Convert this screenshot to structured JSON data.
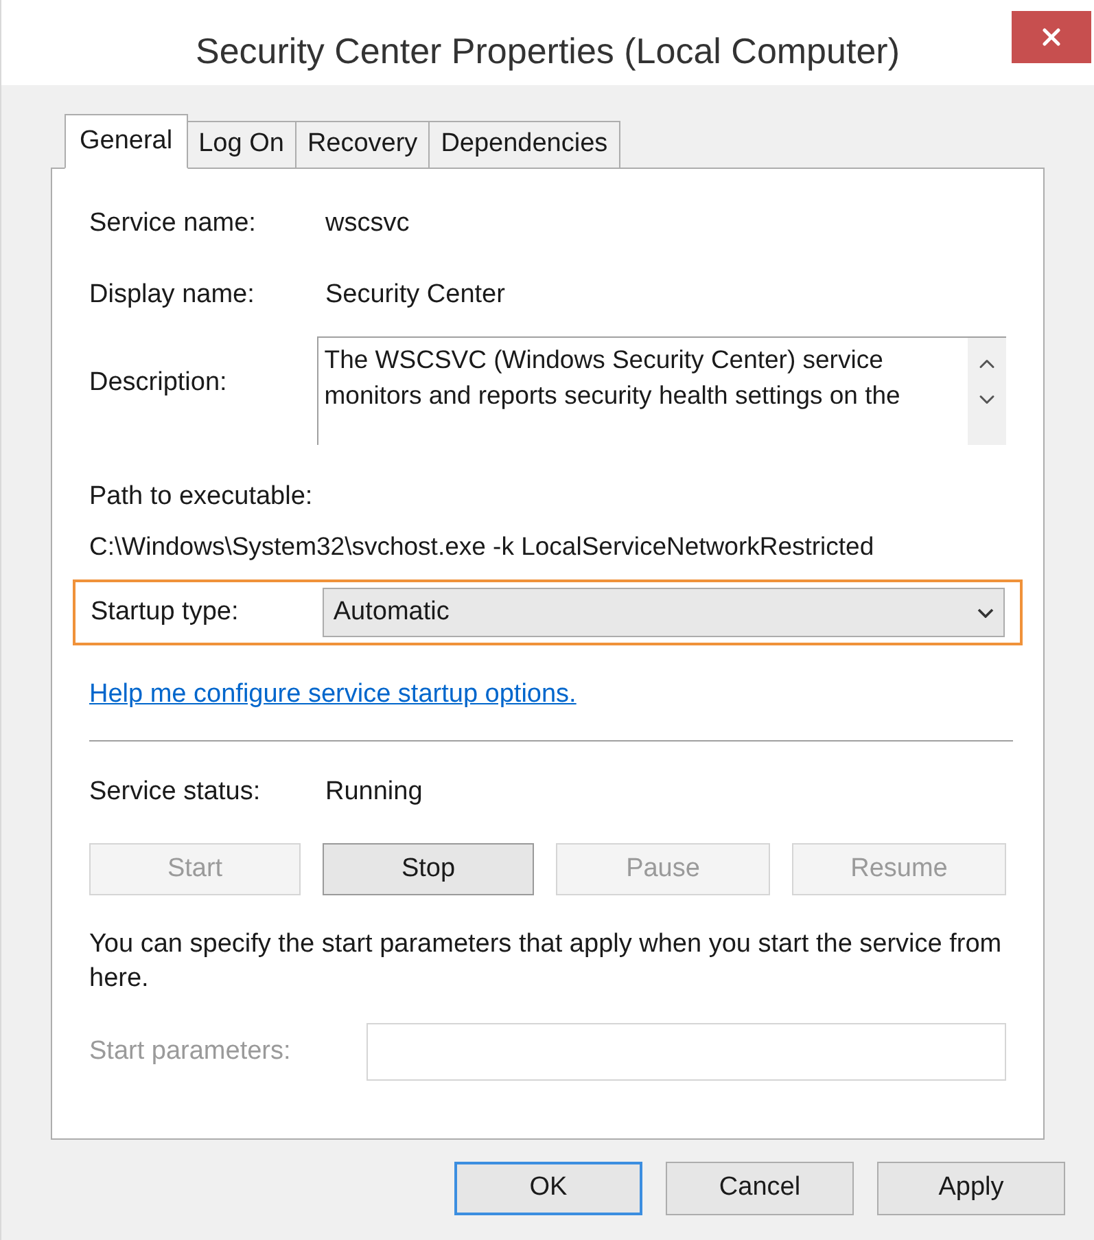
{
  "window": {
    "title": "Security Center Properties (Local Computer)"
  },
  "tabs": [
    {
      "label": "General",
      "selected": true
    },
    {
      "label": "Log On",
      "selected": false
    },
    {
      "label": "Recovery",
      "selected": false
    },
    {
      "label": "Dependencies",
      "selected": false
    }
  ],
  "service_name": {
    "label": "Service name:",
    "value": "wscsvc"
  },
  "display_name": {
    "label": "Display name:",
    "value": "Security Center"
  },
  "description": {
    "label": "Description:",
    "value": "The WSCSVC (Windows Security Center) service monitors and reports security health settings on the"
  },
  "path": {
    "label": "Path to executable:",
    "value": "C:\\Windows\\System32\\svchost.exe -k LocalServiceNetworkRestricted"
  },
  "startup_type": {
    "label": "Startup type:",
    "value": "Automatic",
    "highlighted": true
  },
  "help_link": "Help me configure service startup options.",
  "service_status": {
    "label": "Service status:",
    "value": "Running"
  },
  "service_buttons": [
    {
      "label": "Start",
      "disabled": true
    },
    {
      "label": "Stop",
      "disabled": false
    },
    {
      "label": "Pause",
      "disabled": true
    },
    {
      "label": "Resume",
      "disabled": true
    }
  ],
  "note": "You can specify the start parameters that apply when you start the service from here.",
  "start_parameters": {
    "label": "Start parameters:",
    "disabled": true
  },
  "buttons": [
    {
      "label": "OK",
      "default": true
    },
    {
      "label": "Cancel",
      "default": false
    },
    {
      "label": "Apply",
      "default": false
    }
  ]
}
